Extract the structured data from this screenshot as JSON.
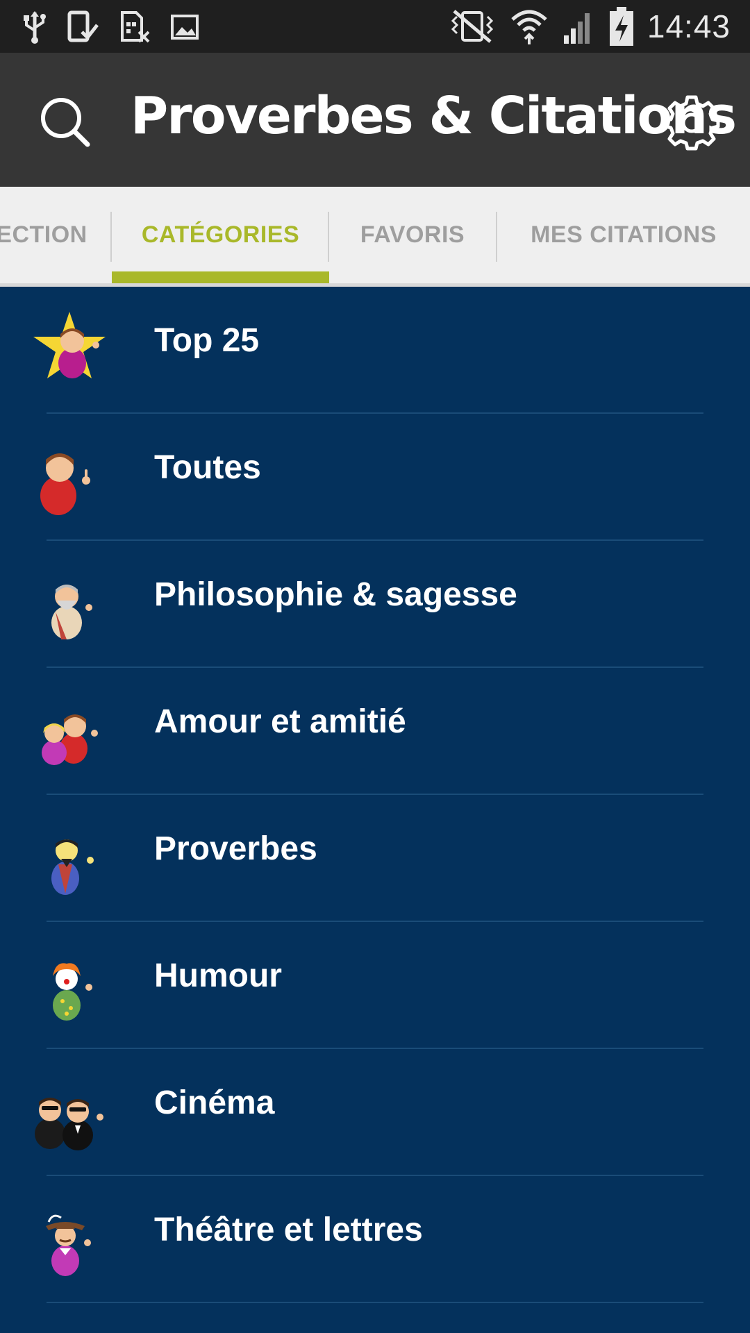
{
  "status_bar": {
    "time": "14:43",
    "left_icons": [
      "usb-icon",
      "download-done-icon",
      "sim-off-icon",
      "image-icon"
    ],
    "right_icons": [
      "vibrate-mute-icon",
      "wifi-icon",
      "signal-icon",
      "battery-charging-icon"
    ]
  },
  "app_bar": {
    "title": "Proverbes & Citations",
    "search_icon": "search-icon",
    "settings_icon": "gear-icon"
  },
  "tabs": [
    {
      "label": "ECTION",
      "active": false
    },
    {
      "label": "CATÉGORIES",
      "active": true
    },
    {
      "label": "FAVORIS",
      "active": false
    },
    {
      "label": "MES CITATIONS",
      "active": false
    }
  ],
  "categories": [
    {
      "label": "Top 25",
      "icon": "star-person-icon"
    },
    {
      "label": "Toutes",
      "icon": "person-icon"
    },
    {
      "label": "Philosophie & sagesse",
      "icon": "philosopher-icon"
    },
    {
      "label": "Amour et amitié",
      "icon": "couple-icon"
    },
    {
      "label": "Proverbes",
      "icon": "sage-icon"
    },
    {
      "label": "Humour",
      "icon": "clown-icon"
    },
    {
      "label": "Cinéma",
      "icon": "agents-icon"
    },
    {
      "label": "Théâtre et lettres",
      "icon": "musketeer-icon"
    }
  ],
  "colors": {
    "accent": "#a9b82a",
    "list_background": "#04315c",
    "app_bar": "#363636",
    "status_bar": "#1f1f1f",
    "tab_bar": "#efefef"
  }
}
